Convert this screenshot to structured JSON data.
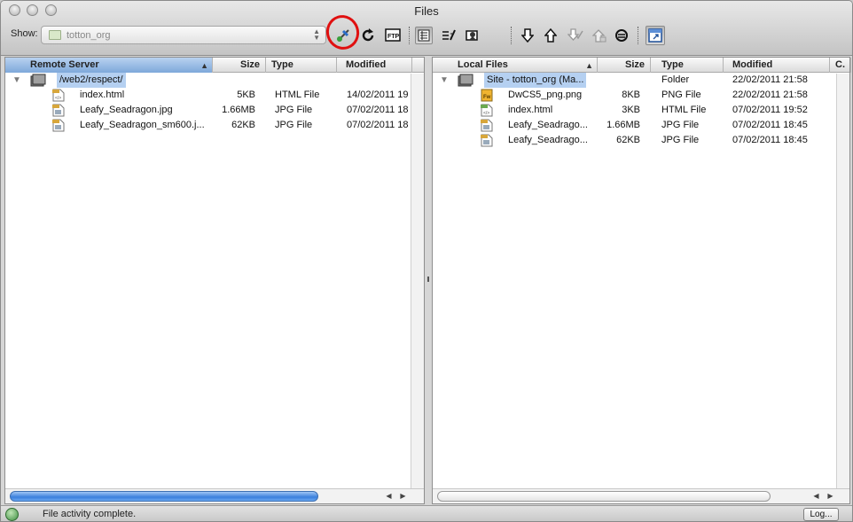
{
  "window": {
    "title": "Files"
  },
  "toolbar": {
    "show_label": "Show:",
    "site_value": "totton_org",
    "icons": [
      "connect-icon",
      "refresh-icon",
      "ftp-log-icon",
      "file-view-icon",
      "site-map-icon",
      "expand-icon",
      "get-icon",
      "put-icon",
      "check-out-icon",
      "check-in-icon",
      "synchronize-icon",
      "expand-collapse-icon"
    ]
  },
  "remote": {
    "columns": [
      "Remote Server",
      "Size",
      "Type",
      "Modified"
    ],
    "folder": "/web2/respect/",
    "files": [
      {
        "name": "index.html",
        "size": "5KB",
        "type": "HTML File",
        "modified": "14/02/2011 19",
        "icon": "html-file-icon"
      },
      {
        "name": "Leafy_Seadragon.jpg",
        "size": "1.66MB",
        "type": "JPG File",
        "modified": "07/02/2011 18",
        "icon": "jpg-file-icon"
      },
      {
        "name": "Leafy_Seadragon_sm600.j...",
        "size": "62KB",
        "type": "JPG File",
        "modified": "07/02/2011 18",
        "icon": "jpg-file-icon"
      }
    ]
  },
  "local": {
    "columns": [
      "Local Files",
      "Size",
      "Type",
      "Modified",
      "C."
    ],
    "root": {
      "name": "Site - totton_org (Ma...",
      "type": "Folder",
      "modified": "22/02/2011 21:58"
    },
    "files": [
      {
        "name": "DwCS5_png.png",
        "size": "8KB",
        "type": "PNG File",
        "modified": "22/02/2011 21:58",
        "icon": "png-file-icon"
      },
      {
        "name": "index.html",
        "size": "3KB",
        "type": "HTML File",
        "modified": "07/02/2011 19:52",
        "icon": "html-file-icon"
      },
      {
        "name": "Leafy_Seadrago...",
        "size": "1.66MB",
        "type": "JPG File",
        "modified": "07/02/2011 18:45",
        "icon": "jpg-file-icon"
      },
      {
        "name": "Leafy_Seadrago...",
        "size": "62KB",
        "type": "JPG File",
        "modified": "07/02/2011 18:45",
        "icon": "jpg-file-icon"
      }
    ]
  },
  "status": {
    "text": "File activity complete.",
    "log_label": "Log..."
  },
  "colors": {
    "selection": "#b5d0f1",
    "sorted_header": "#7ea8da",
    "annotation": "#e01010"
  }
}
